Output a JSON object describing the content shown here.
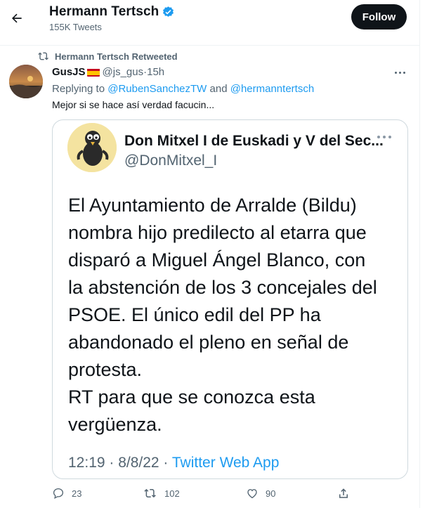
{
  "header": {
    "title": "Hermann Tertsch",
    "tweet_count": "155K Tweets",
    "follow_label": "Follow",
    "icons": {
      "back": "arrow-left-icon",
      "verified": "verified-badge-icon"
    }
  },
  "tweet": {
    "retweet_label": "Hermann Tertsch Retweeted",
    "author_name": "GusJS",
    "author_flag": "flag-spain-icon",
    "handle": "@js_gus",
    "separator": " · ",
    "time": "15h",
    "replying_prefix": "Replying to ",
    "reply_user_1": "@RubenSanchezTW",
    "reply_and": " and ",
    "reply_user_2": "@hermanntertsch",
    "text": "Mejor si se hace así verdad facucin...",
    "embedded": {
      "name": "Don Mitxel I de Euskadi y V del Sec...",
      "handle": "@DonMitxel_I",
      "body": "El Ayuntamiento de Arralde (Bildu)\nnombra hijo predilecto al etarra que\ndisparó a Miguel Ángel Blanco, con\nla abstención de los 3 concejales del\nPSOE. El único edil del PP ha\nabandonado el pleno en señal de\nprotesta.\nRT para que se conozca esta\nvergüenza.",
      "timestamp": "12:19 · 8/8/22 · ",
      "source": "Twitter Web App"
    },
    "actions": {
      "replies": "23",
      "retweets": "102",
      "likes": "90"
    }
  },
  "colors": {
    "accent": "#1d9bf0",
    "text": "#0f1419",
    "muted": "#536471",
    "retweet_icon": "#536471",
    "follow_bg": "#0f1419"
  }
}
